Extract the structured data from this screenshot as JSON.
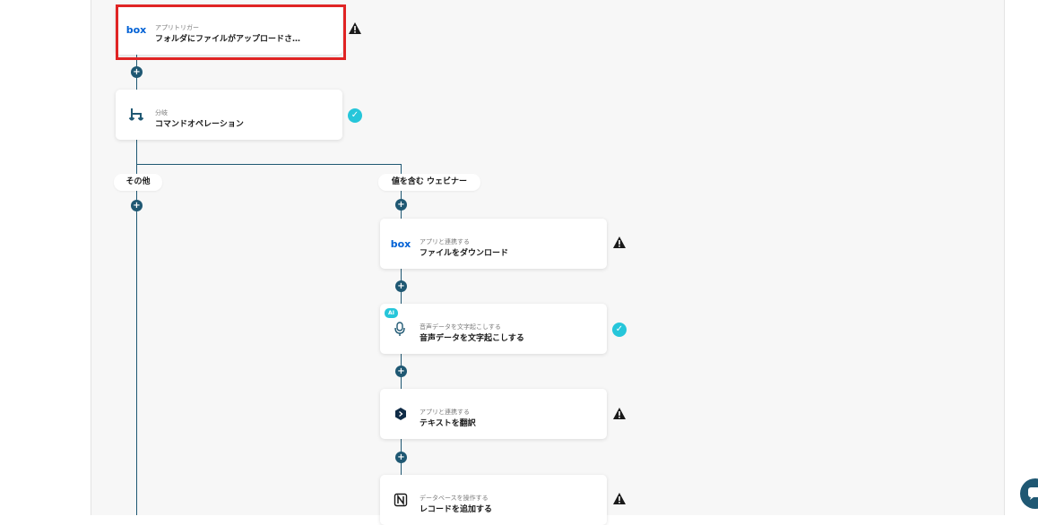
{
  "steps": {
    "trigger": {
      "sub": "アプリトリガー",
      "main": "フォルダにファイルがアップロードさ…",
      "icon": "box-logo-icon",
      "status": "warning"
    },
    "branch": {
      "sub": "分岐",
      "main": "コマンドオペレーション",
      "icon": "branch-icon",
      "status": "ok"
    },
    "download": {
      "sub": "アプリと連携する",
      "main": "ファイルをダウンロード",
      "icon": "box-logo-icon",
      "status": "warning"
    },
    "transcribe": {
      "sub": "音声データを文字起こしする",
      "main": "音声データを文字起こしする",
      "icon": "microphone-icon",
      "status": "ok",
      "badge": "AI"
    },
    "translate": {
      "sub": "アプリと連携する",
      "main": "テキストを翻訳",
      "icon": "deepl-icon",
      "status": "warning"
    },
    "record": {
      "sub": "データベースを操作する",
      "main": "レコードを追加する",
      "icon": "notion-icon",
      "status": "warning"
    }
  },
  "branches": {
    "other_label": "その他",
    "match_label": "値を含む ウェビナー"
  },
  "icons": {
    "box_text": "box"
  },
  "colors": {
    "line": "#1f5873",
    "ok": "#26c6da",
    "selected_border": "#e02424"
  }
}
